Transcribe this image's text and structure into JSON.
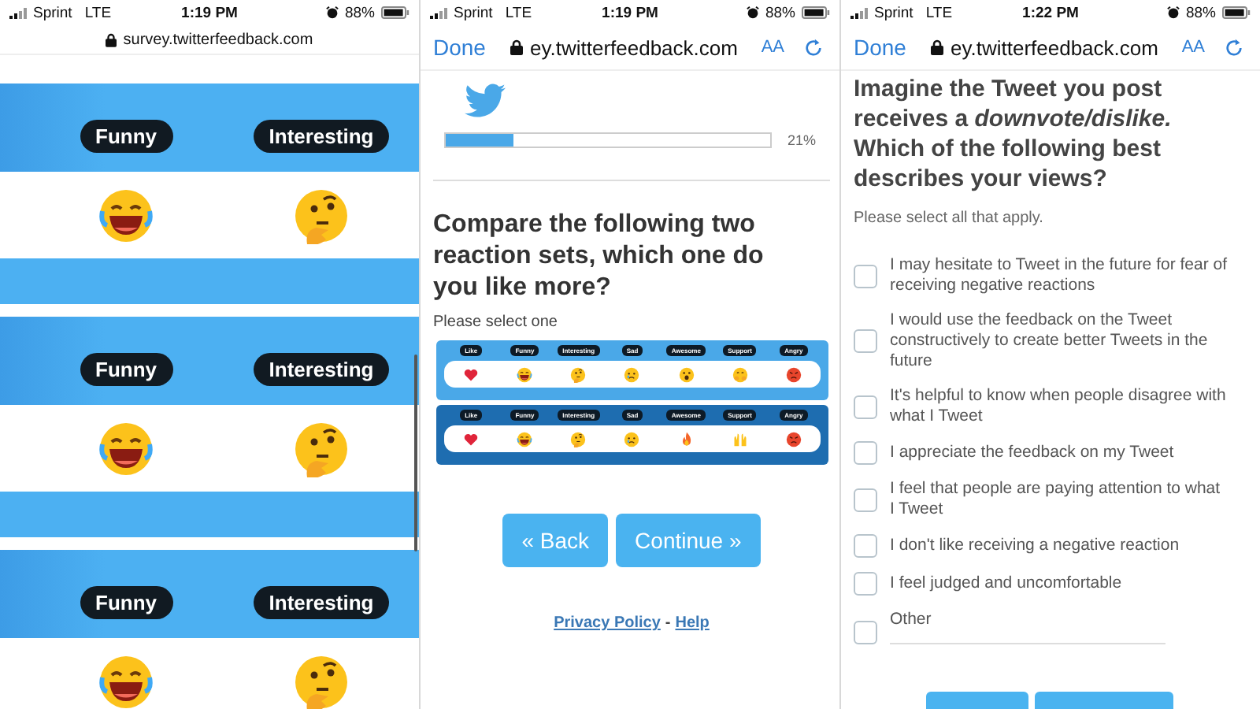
{
  "panels": [
    {
      "kind": "reactions",
      "status_bar": {
        "carrier": "Sprint",
        "network": "LTE",
        "time": "1:19 PM",
        "battery": "88%"
      },
      "address": {
        "url": "survey.twitterfeedback.com"
      },
      "cards": [
        {
          "reactions": [
            {
              "label": "Funny",
              "kind": "laughing"
            },
            {
              "label": "Interesting",
              "kind": "thinking"
            }
          ]
        },
        {
          "reactions": [
            {
              "label": "Funny",
              "kind": "laughing"
            },
            {
              "label": "Interesting",
              "kind": "thinking"
            }
          ]
        },
        {
          "reactions": [
            {
              "label": "Funny",
              "kind": "laughing"
            },
            {
              "label": "Interesting",
              "kind": "thinking"
            }
          ]
        }
      ]
    },
    {
      "kind": "compare",
      "status_bar": {
        "carrier": "Sprint",
        "network": "LTE",
        "time": "1:19 PM",
        "battery": "88%"
      },
      "toolbar": {
        "done": "Done",
        "url": "ey.twitterfeedback.com",
        "text_size": "AA"
      },
      "progress": {
        "level": 0.21,
        "reading": "21%"
      },
      "question": "Compare the following two reaction sets, which one do you like more?",
      "instruction": "Please select one",
      "reaction_sets": [
        {
          "color": "#4aa8e8",
          "reactions": [
            {
              "label": "Like",
              "kind": "heart"
            },
            {
              "label": "Funny",
              "kind": "laughing"
            },
            {
              "label": "Interesting",
              "kind": "thinking"
            },
            {
              "label": "Sad",
              "kind": "sad"
            },
            {
              "label": "Awesome",
              "kind": "surprised"
            },
            {
              "label": "Support",
              "kind": "hug"
            },
            {
              "label": "Angry",
              "kind": "angry"
            }
          ]
        },
        {
          "color": "#1e6db0",
          "reactions": [
            {
              "label": "Like",
              "kind": "heart"
            },
            {
              "label": "Funny",
              "kind": "laughing"
            },
            {
              "label": "Interesting",
              "kind": "thinking"
            },
            {
              "label": "Sad",
              "kind": "sad"
            },
            {
              "label": "Awesome",
              "kind": "flame"
            },
            {
              "label": "Support",
              "kind": "hands"
            },
            {
              "label": "Angry",
              "kind": "angry"
            }
          ]
        }
      ],
      "buttons": [
        "« Back",
        "Continue »"
      ],
      "footer": {
        "privacy": "Privacy Policy",
        "separator": "-",
        "help": "Help"
      }
    },
    {
      "kind": "checklist",
      "status_bar": {
        "carrier": "Sprint",
        "network": "LTE",
        "time": "1:22 PM",
        "battery": "88%"
      },
      "toolbar": {
        "done": "Done",
        "url": "ey.twitterfeedback.com",
        "text_size": "AA"
      },
      "question": "Imagine the Tweet you post receives a *downvote/dislike.* Which of the following best describes your views?",
      "instruction": "Please select all that apply.",
      "options": [
        {
          "label": "I may hesitate to Tweet in the future for fear of receiving negative reactions",
          "checked": false
        },
        {
          "label": "I would use the feedback on the Tweet constructively to create better Tweets in the future",
          "checked": false
        },
        {
          "label": "It's helpful to know when people disagree with what I Tweet",
          "checked": false
        },
        {
          "label": "I appreciate the feedback on my Tweet",
          "checked": false
        },
        {
          "label": "I feel that people are paying attention to what I Tweet",
          "checked": false
        },
        {
          "label": "I don't like receiving a negative reaction",
          "checked": false
        },
        {
          "label": "I feel judged and uncomfortable",
          "checked": false
        }
      ],
      "other": {
        "label": "Other",
        "checked": false
      },
      "cut_buttons": [
        {
          "wide": false
        },
        {
          "wide": true
        }
      ]
    }
  ]
}
